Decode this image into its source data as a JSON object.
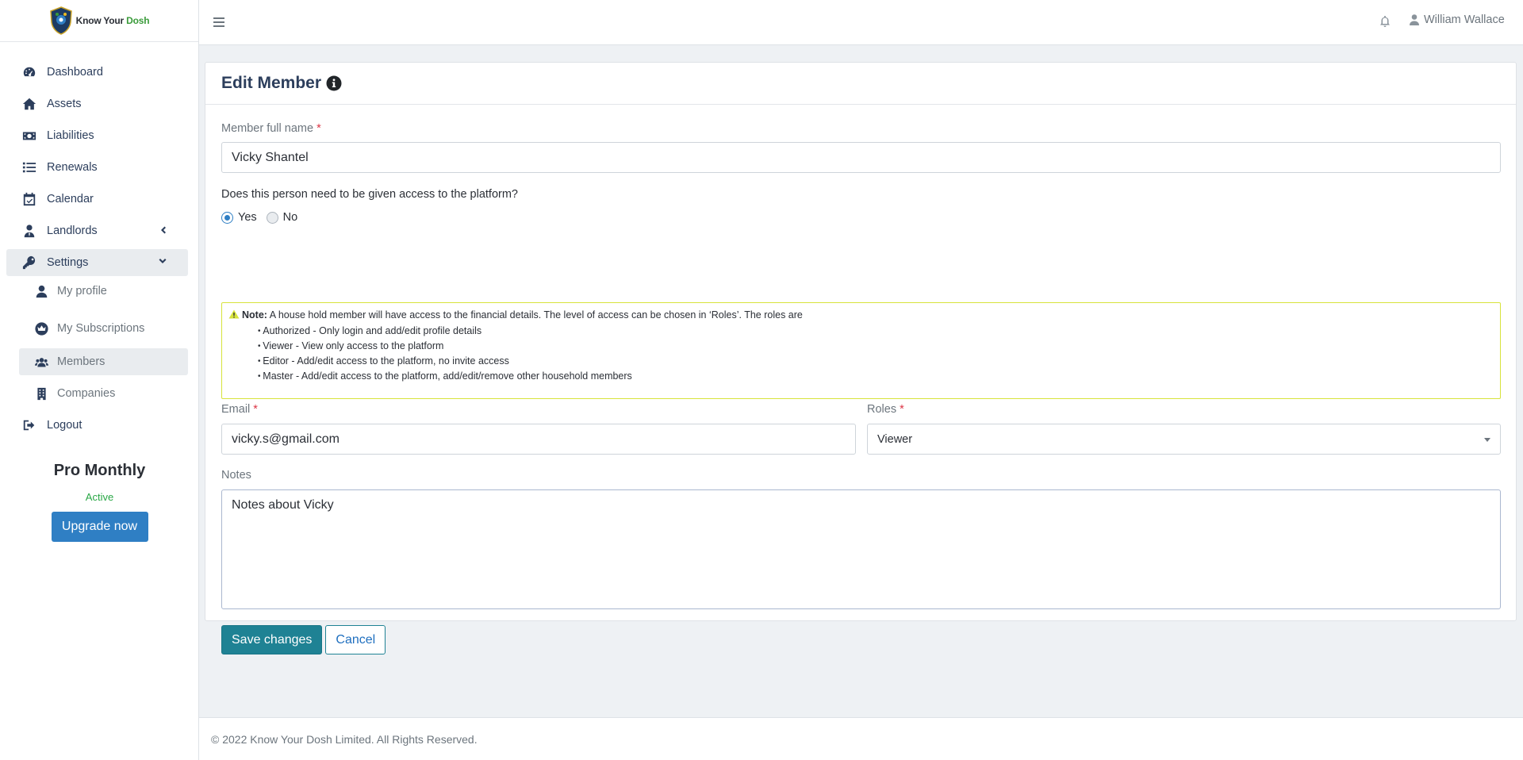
{
  "brand": {
    "name_prefix": "Know Your ",
    "name_suffix": "Dosh"
  },
  "sidebar": {
    "items": [
      {
        "label": "Dashboard",
        "icon": "gauge-icon"
      },
      {
        "label": "Assets",
        "icon": "home-icon"
      },
      {
        "label": "Liabilities",
        "icon": "money-icon"
      },
      {
        "label": "Renewals",
        "icon": "list-icon"
      },
      {
        "label": "Calendar",
        "icon": "calendar-check-icon"
      },
      {
        "label": "Landlords",
        "icon": "user-tie-icon"
      },
      {
        "label": "Settings",
        "icon": "key-icon"
      }
    ],
    "sub_items": [
      {
        "label": "My profile",
        "icon": "user-icon"
      },
      {
        "label": "My Subscriptions",
        "icon": "crown-icon"
      },
      {
        "label": "Members",
        "icon": "users-icon"
      },
      {
        "label": "Companies",
        "icon": "building-icon"
      }
    ],
    "logout": "Logout",
    "plan": {
      "name": "Pro Monthly",
      "status": "Active",
      "upgrade_label": "Upgrade now"
    }
  },
  "topbar": {
    "user_name": "William Wallace"
  },
  "form": {
    "title": "Edit Member",
    "full_name": {
      "label": "Member full name",
      "required": "*",
      "value": "Vicky Shantel"
    },
    "access_question": "Does this person need to be given access to the platform?",
    "access_yes": "Yes",
    "access_no": "No",
    "note": {
      "label": "Note:",
      "text": " A house hold member will have access to the financial details. The level of access can be chosen in ‘Roles’. The roles are",
      "roles": [
        "Authorized - Only login and add/edit profile details",
        "Viewer - View only access to the platform",
        "Editor - Add/edit access to the platform, no invite access",
        "Master - Add/edit access to the platform, add/edit/remove other household members"
      ]
    },
    "email": {
      "label": "Email",
      "required": "*",
      "value": "vicky.s@gmail.com"
    },
    "roles": {
      "label": "Roles",
      "required": "*",
      "value": "Viewer"
    },
    "notes": {
      "label": "Notes",
      "value": "Notes about Vicky"
    },
    "save_label": "Save changes",
    "cancel_label": "Cancel"
  },
  "footer": {
    "text": "© 2022 Know Your Dosh Limited. All Rights Reserved."
  },
  "colors": {
    "primary": "#2f7fc4",
    "teal": "#1f8294",
    "heading": "#2c3e5c",
    "active_green": "#28a745",
    "note_border": "#d7e33b"
  }
}
